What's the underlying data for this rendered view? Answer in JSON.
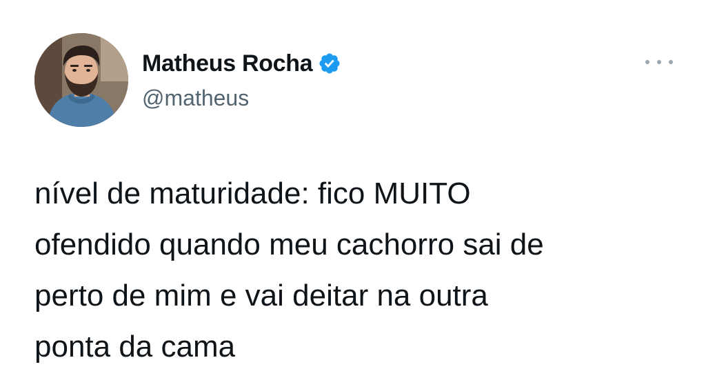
{
  "tweet": {
    "author": {
      "display_name": "Matheus Rocha",
      "handle": "@matheus",
      "verified": true,
      "avatar_icon": "profile-photo"
    },
    "more_icon": "more-options-icon",
    "text": "nível de maturidade: fico MUITO\nofendido quando meu cachorro sai de\nperto de mim e vai deitar na outra\nponta da cama"
  },
  "colors": {
    "text_primary": "#0f1419",
    "text_secondary": "#536471",
    "verified_badge": "#1d9bf0",
    "background": "#ffffff"
  }
}
